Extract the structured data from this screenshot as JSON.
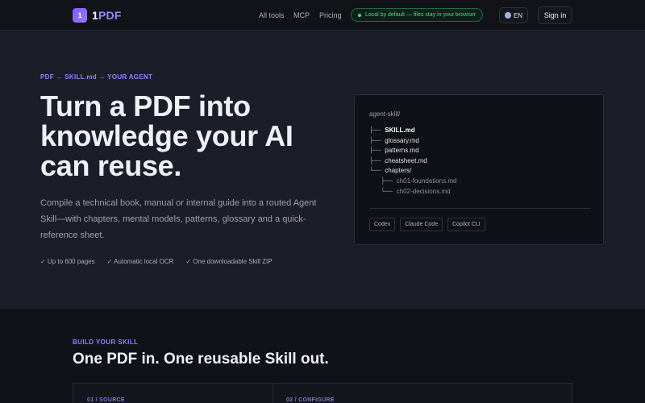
{
  "header": {
    "logo_mark": "1",
    "logo_prefix": "1",
    "logo_suffix": "PDF",
    "nav": [
      "All tools",
      "MCP",
      "Pricing"
    ],
    "local_badge": "Local by default — files stay in your browser",
    "language": "EN",
    "signin": "Sign in",
    "colors": {
      "accent": "#8d84f5",
      "badge": "#4ad98a"
    }
  },
  "hero": {
    "eyebrow": "PDF → SKILL.md → YOUR AGENT",
    "headline": "Turn a PDF into knowledge your AI can reuse.",
    "subtitle": "Compile a technical book, manual or internal guide into a routed Agent Skill—with chapters, mental models, patterns, glossary and a quick-reference sheet.",
    "checks": [
      "✓ Up to 600 pages",
      "✓ Automatic local OCR",
      "✓ One downloadable Skill ZIP"
    ]
  },
  "tree": {
    "root": "agent-skill/",
    "items": [
      {
        "branch": "├──",
        "name": "SKILL.md"
      },
      {
        "branch": "├──",
        "name": "glossary.md"
      },
      {
        "branch": "├──",
        "name": "patterns.md"
      },
      {
        "branch": "├──",
        "name": "cheatsheet.md"
      },
      {
        "branch": "└──",
        "name": "chapters/"
      }
    ],
    "children": [
      {
        "branch": "├──",
        "name": "ch01-foundations.md"
      },
      {
        "branch": "└──",
        "name": "ch02-decisions.md"
      }
    ],
    "agents": [
      "Codex",
      "Claude Code",
      "Copilot CLI"
    ]
  },
  "build": {
    "label": "BUILD YOUR SKILL",
    "title": "One PDF in. One reusable Skill out.",
    "steps": [
      "01 / SOURCE",
      "02 / CONFIGURE"
    ]
  }
}
